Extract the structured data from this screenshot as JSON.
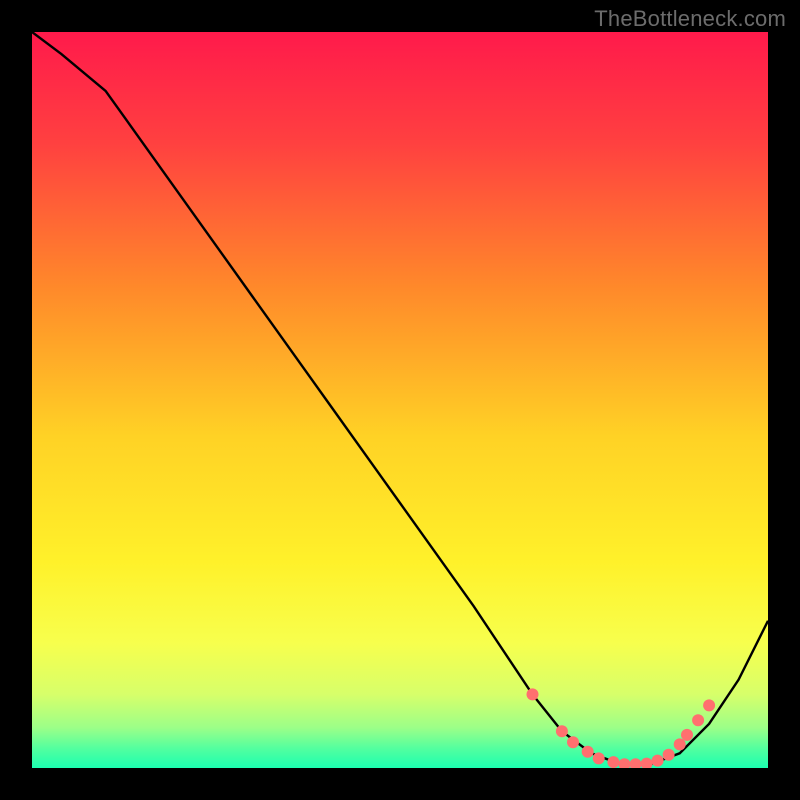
{
  "attribution": "TheBottleneck.com",
  "chart_data": {
    "type": "line",
    "title": "",
    "xlabel": "",
    "ylabel": "",
    "xlim": [
      0,
      100
    ],
    "ylim": [
      0,
      100
    ],
    "grid": false,
    "legend": false,
    "gradient_stops": [
      {
        "offset": 0.0,
        "color": "#ff1a4b"
      },
      {
        "offset": 0.15,
        "color": "#ff4040"
      },
      {
        "offset": 0.35,
        "color": "#ff8a2a"
      },
      {
        "offset": 0.55,
        "color": "#ffd225"
      },
      {
        "offset": 0.72,
        "color": "#fff12a"
      },
      {
        "offset": 0.83,
        "color": "#f7ff4d"
      },
      {
        "offset": 0.9,
        "color": "#d7ff6a"
      },
      {
        "offset": 0.945,
        "color": "#9cff88"
      },
      {
        "offset": 0.975,
        "color": "#4fffa0"
      },
      {
        "offset": 1.0,
        "color": "#1cffb0"
      }
    ],
    "series": [
      {
        "name": "bottleneck-curve",
        "color": "#000000",
        "x": [
          0,
          4,
          10,
          20,
          30,
          40,
          50,
          60,
          68,
          72,
          76,
          80,
          84,
          88,
          92,
          96,
          100
        ],
        "y": [
          100,
          97,
          92,
          78,
          64,
          50,
          36,
          22,
          10,
          5,
          2,
          0.5,
          0.5,
          2,
          6,
          12,
          20
        ]
      }
    ],
    "markers": {
      "name": "highlight-dots",
      "color": "#ff6f6f",
      "radius_px": 6,
      "points": [
        {
          "x": 68,
          "y": 10
        },
        {
          "x": 72,
          "y": 5
        },
        {
          "x": 73.5,
          "y": 3.5
        },
        {
          "x": 75.5,
          "y": 2.2
        },
        {
          "x": 77,
          "y": 1.3
        },
        {
          "x": 79,
          "y": 0.8
        },
        {
          "x": 80.5,
          "y": 0.5
        },
        {
          "x": 82,
          "y": 0.5
        },
        {
          "x": 83.5,
          "y": 0.6
        },
        {
          "x": 85,
          "y": 1.0
        },
        {
          "x": 86.5,
          "y": 1.8
        },
        {
          "x": 88,
          "y": 3.2
        },
        {
          "x": 89,
          "y": 4.5
        },
        {
          "x": 90.5,
          "y": 6.5
        },
        {
          "x": 92,
          "y": 8.5
        }
      ]
    }
  }
}
